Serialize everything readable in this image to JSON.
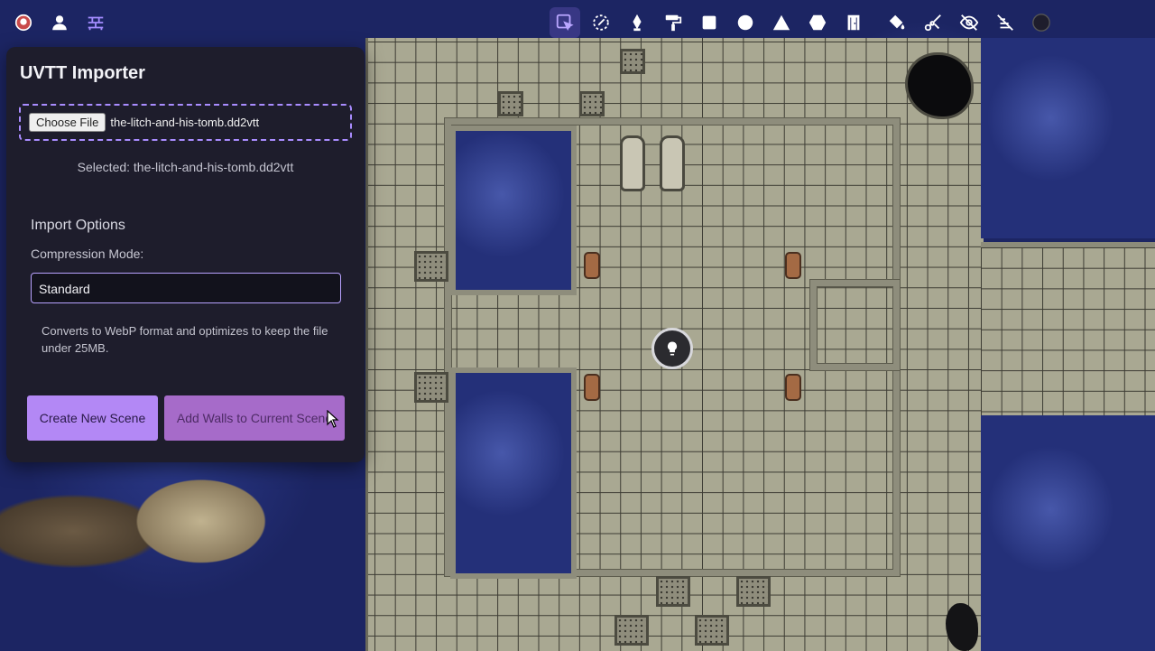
{
  "toolbar": {
    "left": [
      {
        "icon": "avatar-icon"
      },
      {
        "icon": "user-icon"
      },
      {
        "icon": "brick-wall-icon"
      }
    ],
    "right": [
      {
        "icon": "select-pointer-icon",
        "active": true
      },
      {
        "icon": "brush-eraser-icon"
      },
      {
        "icon": "pen-nib-icon"
      },
      {
        "icon": "paint-roller-icon"
      },
      {
        "icon": "square-icon"
      },
      {
        "icon": "circle-icon"
      },
      {
        "icon": "triangle-icon"
      },
      {
        "icon": "hexagon-icon"
      },
      {
        "icon": "door-icon"
      },
      {
        "icon": "paint-bucket-icon"
      },
      {
        "icon": "scissors-icon"
      },
      {
        "icon": "eye-off-icon"
      },
      {
        "icon": "hide-walls-icon"
      },
      {
        "icon": "color-swatch-icon"
      }
    ],
    "accent": "#b9a6ff"
  },
  "panel": {
    "title": "UVTT Importer",
    "choose_file_label": "Choose File",
    "file_name": "the-litch-and-his-tomb.dd2vtt",
    "selected_text": "Selected: the-litch-and-his-tomb.dd2vtt",
    "import_options_title": "Import Options",
    "compression_label": "Compression Mode:",
    "compression_value": "Standard",
    "description": "Converts to WebP format and optimizes to keep the file under 25MB.",
    "create_button": "Create New Scene",
    "walls_button": "Add Walls to Current Scene",
    "colors": {
      "panel_bg": "#1e1d2c",
      "create_bg": "#b388f5",
      "walls_bg": "#a66bc9",
      "focus_border": "#a98cff"
    }
  }
}
